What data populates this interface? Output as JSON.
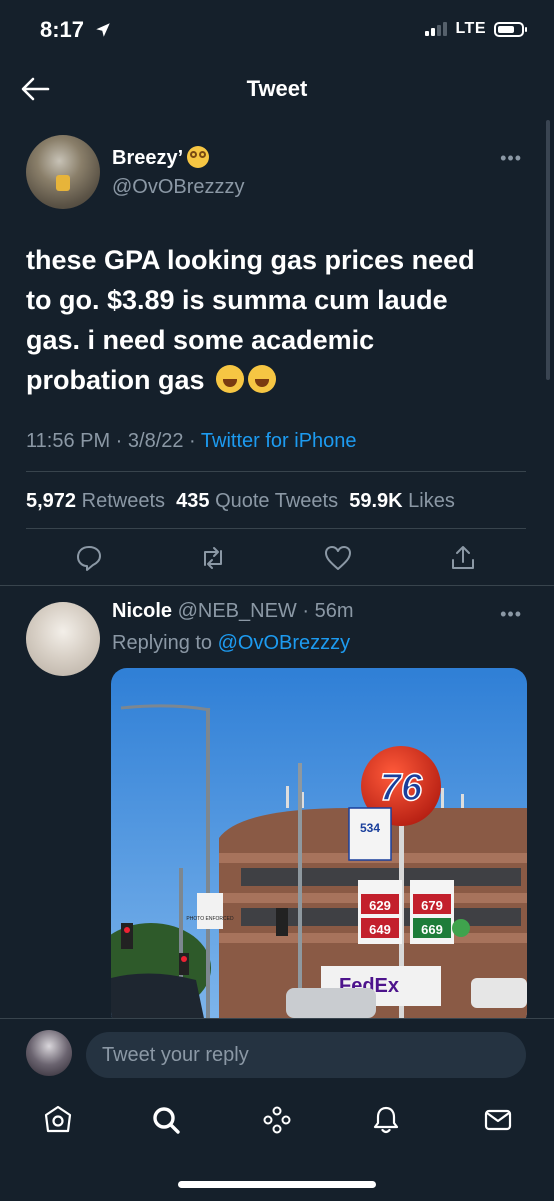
{
  "status_bar": {
    "time": "8:17",
    "network": "LTE"
  },
  "header": {
    "title": "Tweet"
  },
  "tweet": {
    "author_name": "Breezy’",
    "author_handle": "@OvOBrezzzy",
    "text_line1": "these GPA looking gas prices need",
    "text_line2": "to go. $3.89 is summa cum laude",
    "text_line3": "gas. i need some academic",
    "text_line4": "probation gas",
    "timestamp": "11:56 PM · 3/8/22 · ",
    "source": "Twitter for iPhone",
    "retweets_count": "5,972",
    "retweets_label": "Retweets",
    "quotes_count": "435",
    "quotes_label": "Quote Tweets",
    "likes_count": "59.9K",
    "likes_label": "Likes"
  },
  "reply": {
    "author_name": "Nicole",
    "author_handle": "@NEB_NEW",
    "age": "· 56m",
    "replying_prefix": "Replying to",
    "replying_to": "@OvOBrezzzy"
  },
  "photo_signs": {
    "logo": "76",
    "coffee": "534",
    "regular": "629",
    "plus": "649",
    "premium": "679",
    "diesel": "669",
    "photo_enforced": "PHOTO ENFORCED",
    "fedex": "FedEx"
  },
  "composer": {
    "placeholder": "Tweet your reply"
  },
  "colors": {
    "background": "#15202b",
    "accent": "#1d9bf0",
    "muted": "#8b98a5"
  }
}
